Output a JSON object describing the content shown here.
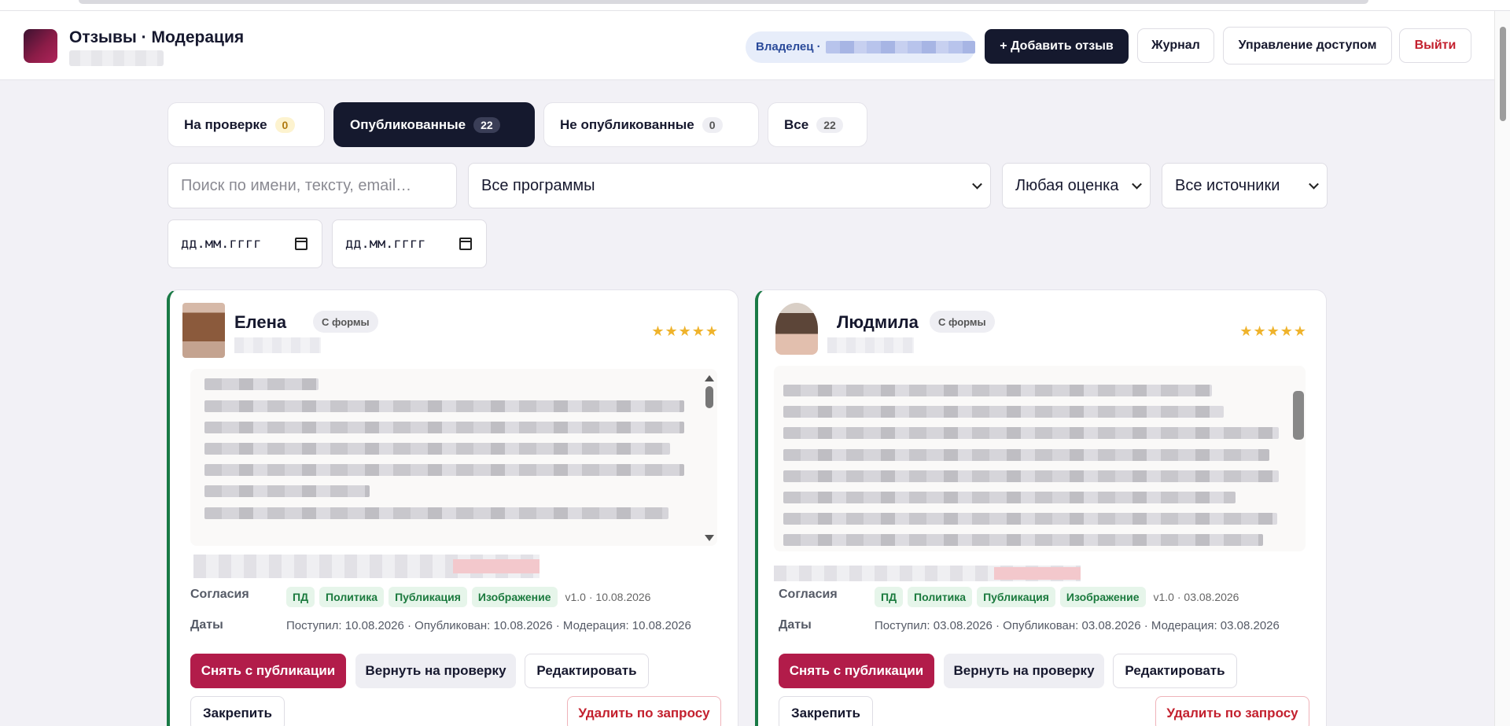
{
  "app": {
    "title": "Отзывы · Модерация"
  },
  "header": {
    "owner_label": "Владелец ·",
    "add_review": "+ Добавить отзыв",
    "journal": "Журнал",
    "access": "Управление доступом",
    "logout": "Выйти"
  },
  "tabs": [
    {
      "label": "На проверке",
      "count": "0"
    },
    {
      "label": "Опубликованные",
      "count": "22"
    },
    {
      "label": "Не опубликованные",
      "count": "0"
    },
    {
      "label": "Все",
      "count": "22"
    }
  ],
  "filters": {
    "search_placeholder": "Поиск по имени, тексту, email…",
    "program": "Все программы",
    "rating": "Любая оценка",
    "source": "Все источники",
    "date_from": "дд.мм.гггг",
    "date_to": "дд.мм.гггг"
  },
  "labels": {
    "consents": "Согласия",
    "dates": "Даты"
  },
  "cards": [
    {
      "name": "Елена",
      "source": "С формы",
      "stars": "★★★★★",
      "consents": [
        "ПД",
        "Политика",
        "Публикация",
        "Изображение"
      ],
      "version": "v1.0 · 10.08.2026",
      "dates": "Поступил: 10.08.2026 · Опубликован: 10.08.2026 · Модерация: 10.08.2026",
      "actions": {
        "unpublish": "Снять с публикации",
        "return": "Вернуть на проверку",
        "edit": "Редактировать",
        "pin": "Закрепить",
        "delete": "Удалить по запросу"
      }
    },
    {
      "name": "Людмила",
      "source": "С формы",
      "stars": "★★★★★",
      "consents": [
        "ПД",
        "Политика",
        "Публикация",
        "Изображение"
      ],
      "version": "v1.0 · 03.08.2026",
      "dates": "Поступил: 03.08.2026 · Опубликован: 03.08.2026 · Модерация: 03.08.2026",
      "actions": {
        "unpublish": "Снять с публикации",
        "return": "Вернуть на проверку",
        "edit": "Редактировать",
        "pin": "Закрепить",
        "delete": "Удалить по запросу"
      }
    }
  ],
  "colors": {
    "accent_dark": "#15192e",
    "primary_red": "#b21c4a",
    "published_border": "#1a7a46",
    "star": "#efb32c"
  }
}
